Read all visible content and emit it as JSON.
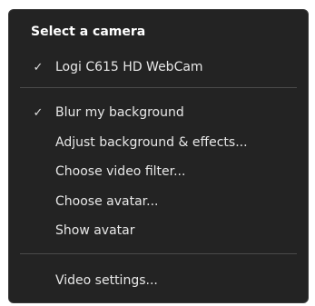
{
  "menu": {
    "header": "Select a camera",
    "camera_items": [
      {
        "label": "Logi C615 HD WebCam",
        "checked": true
      }
    ],
    "effect_items": [
      {
        "label": "Blur my background",
        "checked": true
      },
      {
        "label": "Adjust background & effects...",
        "checked": false
      },
      {
        "label": "Choose video filter...",
        "checked": false
      },
      {
        "label": "Choose avatar...",
        "checked": false
      },
      {
        "label": "Show avatar",
        "checked": false
      }
    ],
    "settings_items": [
      {
        "label": "Video settings...",
        "checked": false
      }
    ],
    "check_glyph": "✓",
    "colors": {
      "background": "#232323",
      "text": "#e8e8e8",
      "separator": "#4a4a4a"
    }
  }
}
